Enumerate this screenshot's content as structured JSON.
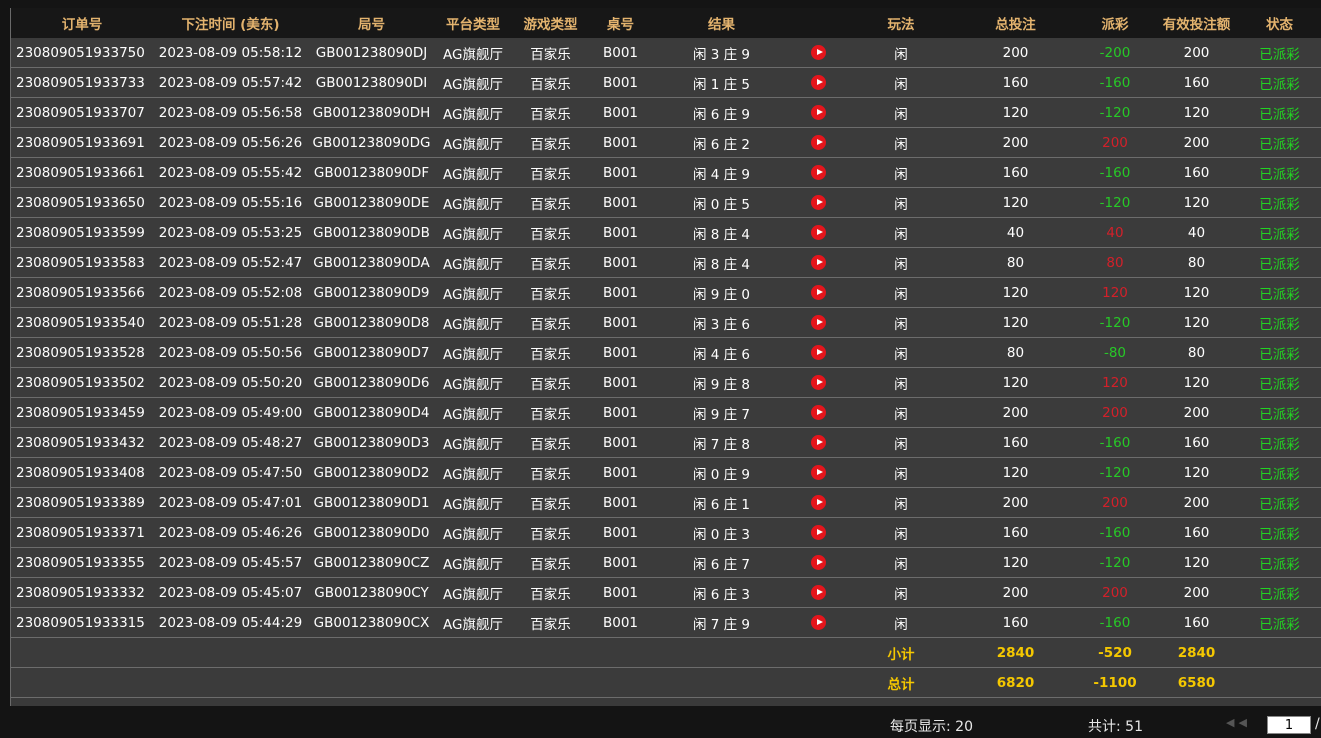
{
  "headers": [
    "订单号",
    "下注时间 (美东)",
    "局号",
    "平台类型",
    "游戏类型",
    "桌号",
    "结果",
    "",
    "玩法",
    "总投注",
    "派彩",
    "有效投注额",
    "状态"
  ],
  "rows": [
    {
      "id": "230809051933750",
      "time": "2023-08-09 05:58:12",
      "round": "GB001238090DJ",
      "platform": "AG旗舰厅",
      "game": "百家乐",
      "table": "B001",
      "result": "闲 3 庄 9",
      "bet_type": "闲",
      "total": "200",
      "payout": "-200",
      "payout_type": "win",
      "valid": "200",
      "status": "已派彩"
    },
    {
      "id": "230809051933733",
      "time": "2023-08-09 05:57:42",
      "round": "GB001238090DI",
      "platform": "AG旗舰厅",
      "game": "百家乐",
      "table": "B001",
      "result": "闲 1 庄 5",
      "bet_type": "闲",
      "total": "160",
      "payout": "-160",
      "payout_type": "win",
      "valid": "160",
      "status": "已派彩"
    },
    {
      "id": "230809051933707",
      "time": "2023-08-09 05:56:58",
      "round": "GB001238090DH",
      "platform": "AG旗舰厅",
      "game": "百家乐",
      "table": "B001",
      "result": "闲 6 庄 9",
      "bet_type": "闲",
      "total": "120",
      "payout": "-120",
      "payout_type": "win",
      "valid": "120",
      "status": "已派彩"
    },
    {
      "id": "230809051933691",
      "time": "2023-08-09 05:56:26",
      "round": "GB001238090DG",
      "platform": "AG旗舰厅",
      "game": "百家乐",
      "table": "B001",
      "result": "闲 6 庄 2",
      "bet_type": "闲",
      "total": "200",
      "payout": "200",
      "payout_type": "lose",
      "valid": "200",
      "status": "已派彩"
    },
    {
      "id": "230809051933661",
      "time": "2023-08-09 05:55:42",
      "round": "GB001238090DF",
      "platform": "AG旗舰厅",
      "game": "百家乐",
      "table": "B001",
      "result": "闲 4 庄 9",
      "bet_type": "闲",
      "total": "160",
      "payout": "-160",
      "payout_type": "win",
      "valid": "160",
      "status": "已派彩"
    },
    {
      "id": "230809051933650",
      "time": "2023-08-09 05:55:16",
      "round": "GB001238090DE",
      "platform": "AG旗舰厅",
      "game": "百家乐",
      "table": "B001",
      "result": "闲 0 庄 5",
      "bet_type": "闲",
      "total": "120",
      "payout": "-120",
      "payout_type": "win",
      "valid": "120",
      "status": "已派彩"
    },
    {
      "id": "230809051933599",
      "time": "2023-08-09 05:53:25",
      "round": "GB001238090DB",
      "platform": "AG旗舰厅",
      "game": "百家乐",
      "table": "B001",
      "result": "闲 8 庄 4",
      "bet_type": "闲",
      "total": "40",
      "payout": "40",
      "payout_type": "lose",
      "valid": "40",
      "status": "已派彩"
    },
    {
      "id": "230809051933583",
      "time": "2023-08-09 05:52:47",
      "round": "GB001238090DA",
      "platform": "AG旗舰厅",
      "game": "百家乐",
      "table": "B001",
      "result": "闲 8 庄 4",
      "bet_type": "闲",
      "total": "80",
      "payout": "80",
      "payout_type": "lose",
      "valid": "80",
      "status": "已派彩"
    },
    {
      "id": "230809051933566",
      "time": "2023-08-09 05:52:08",
      "round": "GB001238090D9",
      "platform": "AG旗舰厅",
      "game": "百家乐",
      "table": "B001",
      "result": "闲 9 庄 0",
      "bet_type": "闲",
      "total": "120",
      "payout": "120",
      "payout_type": "lose",
      "valid": "120",
      "status": "已派彩"
    },
    {
      "id": "230809051933540",
      "time": "2023-08-09 05:51:28",
      "round": "GB001238090D8",
      "platform": "AG旗舰厅",
      "game": "百家乐",
      "table": "B001",
      "result": "闲 3 庄 6",
      "bet_type": "闲",
      "total": "120",
      "payout": "-120",
      "payout_type": "win",
      "valid": "120",
      "status": "已派彩"
    },
    {
      "id": "230809051933528",
      "time": "2023-08-09 05:50:56",
      "round": "GB001238090D7",
      "platform": "AG旗舰厅",
      "game": "百家乐",
      "table": "B001",
      "result": "闲 4 庄 6",
      "bet_type": "闲",
      "total": "80",
      "payout": "-80",
      "payout_type": "win",
      "valid": "80",
      "status": "已派彩"
    },
    {
      "id": "230809051933502",
      "time": "2023-08-09 05:50:20",
      "round": "GB001238090D6",
      "platform": "AG旗舰厅",
      "game": "百家乐",
      "table": "B001",
      "result": "闲 9 庄 8",
      "bet_type": "闲",
      "total": "120",
      "payout": "120",
      "payout_type": "lose",
      "valid": "120",
      "status": "已派彩"
    },
    {
      "id": "230809051933459",
      "time": "2023-08-09 05:49:00",
      "round": "GB001238090D4",
      "platform": "AG旗舰厅",
      "game": "百家乐",
      "table": "B001",
      "result": "闲 9 庄 7",
      "bet_type": "闲",
      "total": "200",
      "payout": "200",
      "payout_type": "lose",
      "valid": "200",
      "status": "已派彩"
    },
    {
      "id": "230809051933432",
      "time": "2023-08-09 05:48:27",
      "round": "GB001238090D3",
      "platform": "AG旗舰厅",
      "game": "百家乐",
      "table": "B001",
      "result": "闲 7 庄 8",
      "bet_type": "闲",
      "total": "160",
      "payout": "-160",
      "payout_type": "win",
      "valid": "160",
      "status": "已派彩"
    },
    {
      "id": "230809051933408",
      "time": "2023-08-09 05:47:50",
      "round": "GB001238090D2",
      "platform": "AG旗舰厅",
      "game": "百家乐",
      "table": "B001",
      "result": "闲 0 庄 9",
      "bet_type": "闲",
      "total": "120",
      "payout": "-120",
      "payout_type": "win",
      "valid": "120",
      "status": "已派彩"
    },
    {
      "id": "230809051933389",
      "time": "2023-08-09 05:47:01",
      "round": "GB001238090D1",
      "platform": "AG旗舰厅",
      "game": "百家乐",
      "table": "B001",
      "result": "闲 6 庄 1",
      "bet_type": "闲",
      "total": "200",
      "payout": "200",
      "payout_type": "lose",
      "valid": "200",
      "status": "已派彩"
    },
    {
      "id": "230809051933371",
      "time": "2023-08-09 05:46:26",
      "round": "GB001238090D0",
      "platform": "AG旗舰厅",
      "game": "百家乐",
      "table": "B001",
      "result": "闲 0 庄 3",
      "bet_type": "闲",
      "total": "160",
      "payout": "-160",
      "payout_type": "win",
      "valid": "160",
      "status": "已派彩"
    },
    {
      "id": "230809051933355",
      "time": "2023-08-09 05:45:57",
      "round": "GB001238090CZ",
      "platform": "AG旗舰厅",
      "game": "百家乐",
      "table": "B001",
      "result": "闲 6 庄 7",
      "bet_type": "闲",
      "total": "120",
      "payout": "-120",
      "payout_type": "win",
      "valid": "120",
      "status": "已派彩"
    },
    {
      "id": "230809051933332",
      "time": "2023-08-09 05:45:07",
      "round": "GB001238090CY",
      "platform": "AG旗舰厅",
      "game": "百家乐",
      "table": "B001",
      "result": "闲 6 庄 3",
      "bet_type": "闲",
      "total": "200",
      "payout": "200",
      "payout_type": "lose",
      "valid": "200",
      "status": "已派彩"
    },
    {
      "id": "230809051933315",
      "time": "2023-08-09 05:44:29",
      "round": "GB001238090CX",
      "platform": "AG旗舰厅",
      "game": "百家乐",
      "table": "B001",
      "result": "闲 7 庄 9",
      "bet_type": "闲",
      "total": "160",
      "payout": "-160",
      "payout_type": "win",
      "valid": "160",
      "status": "已派彩"
    }
  ],
  "subtotal": {
    "label": "小计",
    "total": "2840",
    "payout": "-520",
    "valid": "2840"
  },
  "grandtotal": {
    "label": "总计",
    "total": "6820",
    "payout": "-1100",
    "valid": "6580"
  },
  "footer": {
    "per_page": "每页显示: 20",
    "count": "共计: 51",
    "page": "1",
    "page_suffix": "/"
  },
  "icons": {
    "replay": "play-circle-icon",
    "first_page": "first-page-icon",
    "prev_page": "prev-page-icon"
  },
  "colors": {
    "header_text": "#e3b36e",
    "win": "#27c927",
    "lose": "#d3202a",
    "status": "#22d322",
    "totals": "#f5c800"
  }
}
